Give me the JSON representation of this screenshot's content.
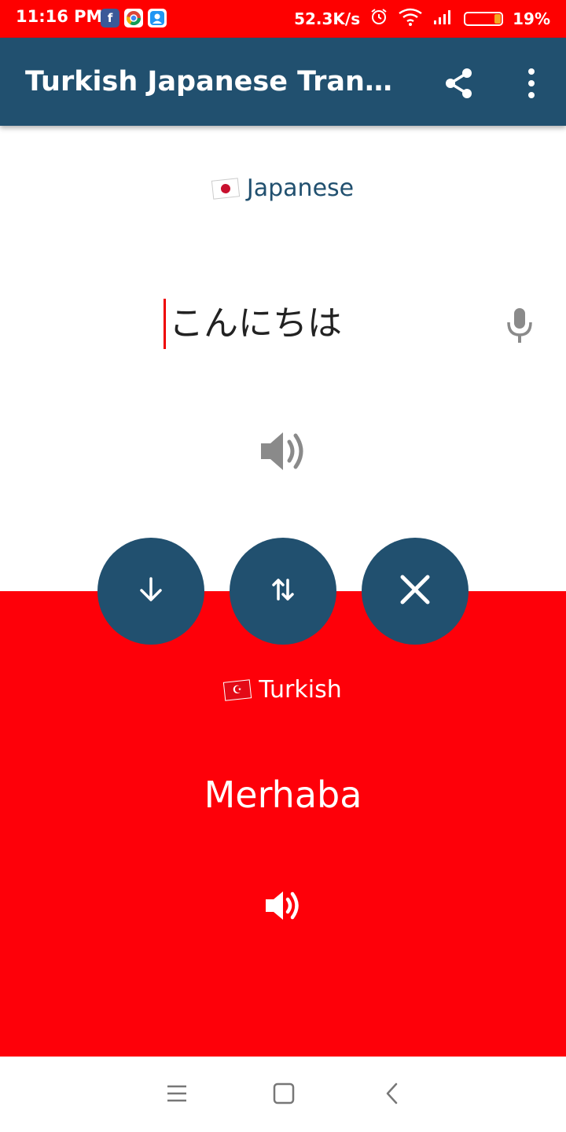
{
  "status_bar": {
    "time": "11:16 PM",
    "app_icons": [
      "facebook-icon",
      "chrome-icon",
      "contacts-icon"
    ],
    "network_speed": "52.3K/s",
    "battery_percent": "19%",
    "battery_level": 0.19,
    "colors": {
      "background": "#fe0000"
    }
  },
  "toolbar": {
    "title": "Turkish Japanese Transl...",
    "share_icon": "share-icon",
    "more_icon": "more-vert-icon",
    "colors": {
      "background": "#21506f"
    }
  },
  "source": {
    "flag": "japan-flag",
    "language": "Japanese",
    "text": "こんにちは",
    "mic_icon": "mic-icon",
    "speaker_icon": "speaker-icon"
  },
  "actions": {
    "translate_icon": "arrow-down-icon",
    "swap_icon": "swap-icon",
    "clear_icon": "close-icon",
    "colors": {
      "button": "#21506f"
    }
  },
  "target": {
    "flag": "turkey-flag",
    "language": "Turkish",
    "text": "Merhaba",
    "speaker_icon": "speaker-icon",
    "colors": {
      "background": "#fe0009"
    }
  },
  "navbar": {
    "menu_icon": "menu-icon",
    "home_icon": "home-square-icon",
    "back_icon": "back-icon"
  }
}
